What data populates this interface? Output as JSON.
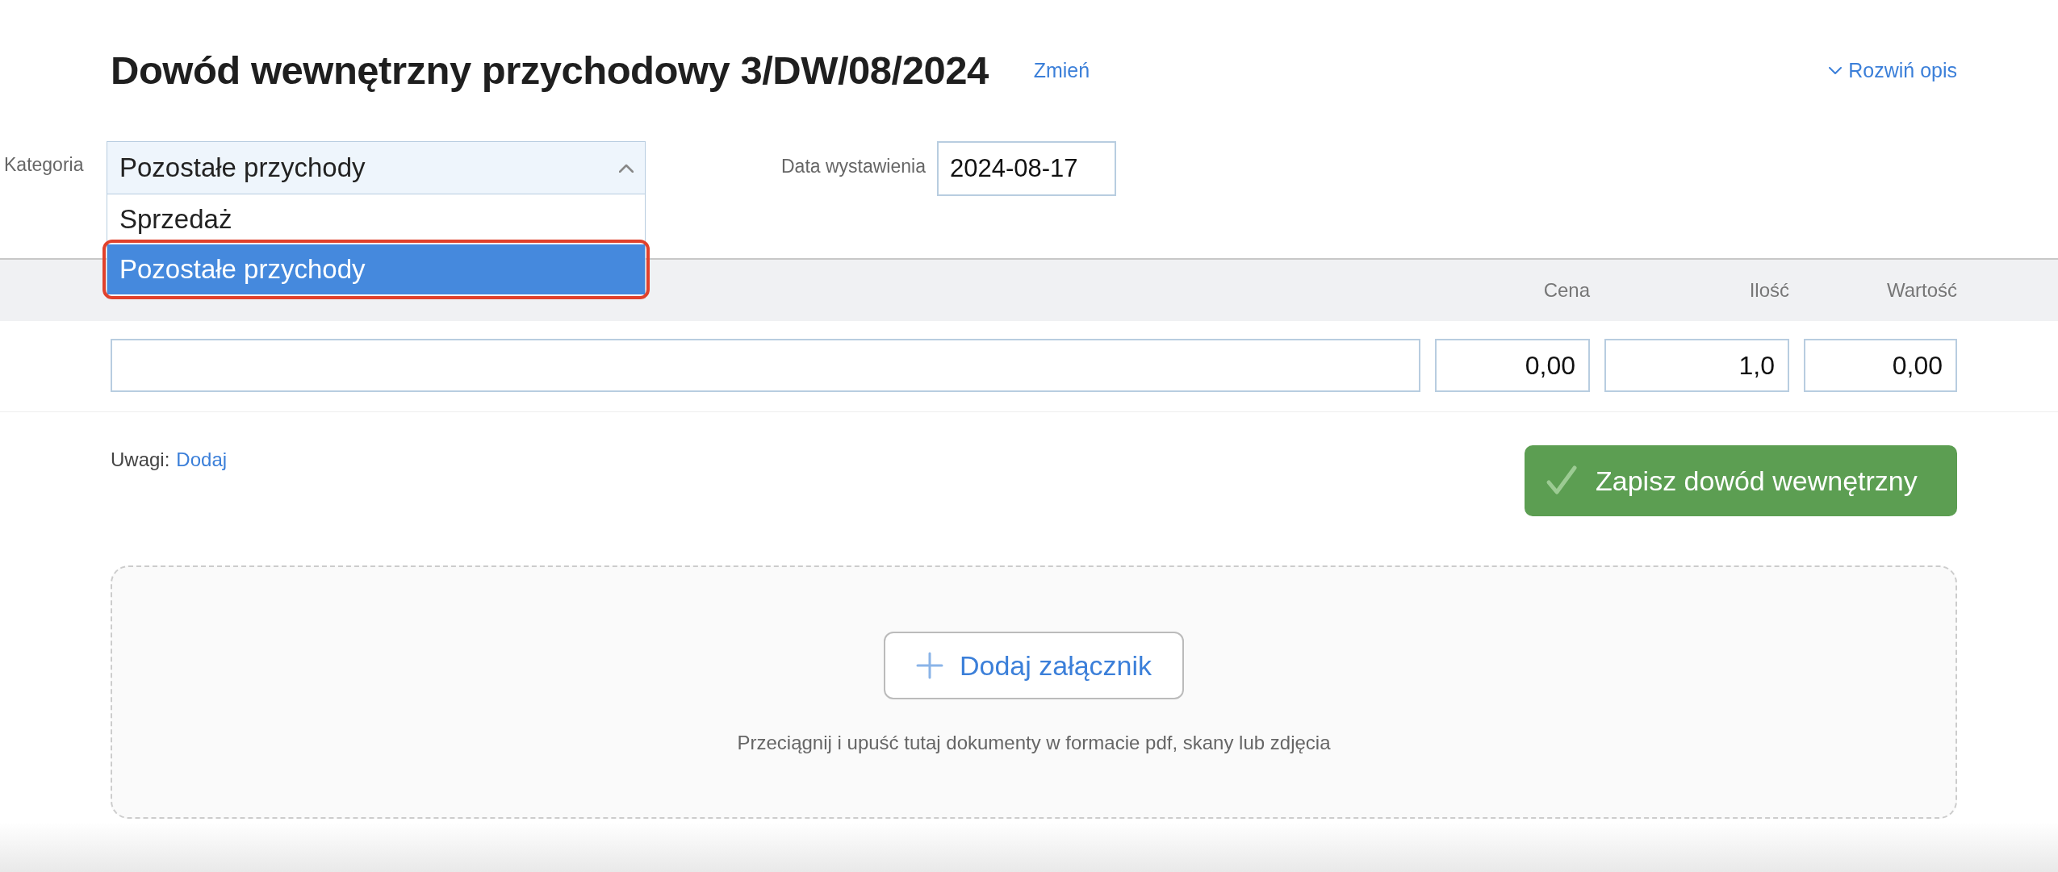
{
  "header": {
    "title": "Dowód wewnętrzny przychodowy 3/DW/08/2024",
    "change_link": "Zmień",
    "expand_link": "Rozwiń opis"
  },
  "category": {
    "label": "Kategoria",
    "value": "Pozostałe przychody",
    "expanded": true,
    "options": [
      {
        "label": "Sprzedaż",
        "selected": false,
        "highlighted": false
      },
      {
        "label": "Pozostałe przychody",
        "selected": true,
        "highlighted": true
      }
    ]
  },
  "issue_date": {
    "label": "Data wystawienia",
    "value": "2024-08-17"
  },
  "items_table": {
    "columns": [
      "Cena",
      "Ilość",
      "Wartość"
    ],
    "rows": [
      {
        "price": "0,00",
        "quantity": "1,0",
        "value": "0,00"
      }
    ]
  },
  "notes": {
    "label": "Uwagi:",
    "link": "Dodaj"
  },
  "save_button": "Zapisz dowód wewnętrzny",
  "attachments": {
    "button": "Dodaj załącznik",
    "hint": "Przeciągnij i upuść tutaj dokumenty w formacie pdf, skany lub zdjęcia"
  }
}
